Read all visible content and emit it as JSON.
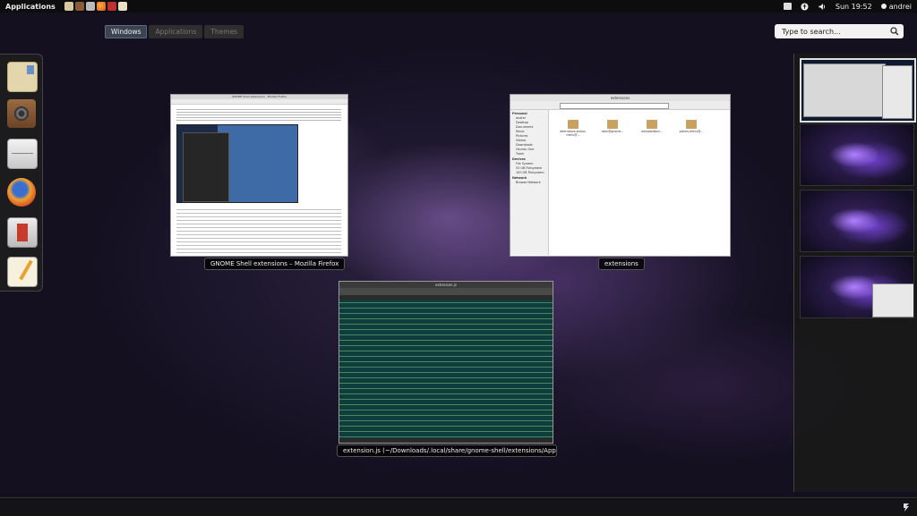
{
  "top_panel": {
    "applications_label": "Applications",
    "launchers": [
      {
        "icon": "mail-icon",
        "color": "#d9c9a0"
      },
      {
        "icon": "speaker-icon",
        "color": "#8a5a3a"
      },
      {
        "icon": "file-cabinet-icon",
        "color": "#bbbbbb"
      },
      {
        "icon": "firefox-icon",
        "color": "#e86f2a"
      },
      {
        "icon": "package-icon",
        "color": "#c03030"
      },
      {
        "icon": "text-editor-icon",
        "color": "#e8e0c0"
      }
    ],
    "clock": "Sun 19:52",
    "user": "andrei",
    "status_icons": [
      "folder-icon",
      "accessibility-icon",
      "volume-icon"
    ]
  },
  "tabs": [
    {
      "label": "Windows",
      "active": true
    },
    {
      "label": "Applications",
      "active": false
    },
    {
      "label": "Themes",
      "active": false
    }
  ],
  "search": {
    "placeholder": "Type to search..."
  },
  "dash": {
    "items": [
      {
        "icon": "mail-icon"
      },
      {
        "icon": "speaker-icon"
      },
      {
        "icon": "file-cabinet-icon"
      },
      {
        "icon": "firefox-icon"
      },
      {
        "icon": "package-icon"
      },
      {
        "icon": "text-editor-icon"
      }
    ]
  },
  "windows": [
    {
      "app": "firefox",
      "caption": "GNOME Shell extensions – Mozilla Firefox",
      "title": "GNOME Shell extensions - Mozilla Firefox"
    },
    {
      "app": "nautilus",
      "caption": "extensions",
      "title": "extensions",
      "sidebar": [
        "Personal",
        "andrei",
        "Desktop",
        "Documents",
        "Music",
        "Pictures",
        "Videos",
        "Downloads",
        "Ubuntu One",
        "Trash",
        "Devices",
        "File System",
        "53 GB Filesystem",
        "100 GB Filesystem",
        "Network",
        "Browse Network"
      ],
      "folders": [
        "alternative-status-menu@gnome-shell-extensions.gcampax.github.com",
        "dock@gnome-shell-extensions.gcampax.github.com",
        "windowsNavigator@gnome-shell-extensions.gcampax.github.com",
        "places-menu@gnome-shell-extensions.gcampax.github.com"
      ],
      "folders_short": [
        "alternative-status-menu@...",
        "dock@gnome...",
        "windowsNavi...",
        "places-menu@..."
      ]
    },
    {
      "app": "gedit",
      "caption": "extension.js (~/Downloads/.local/share/gnome-shell/extensions/App...",
      "title": "extension.js"
    }
  ],
  "workspaces": [
    {
      "index": 1,
      "active": true
    },
    {
      "index": 2,
      "active": false
    },
    {
      "index": 3,
      "active": false
    },
    {
      "index": 4,
      "active": false
    }
  ],
  "tray": {
    "icon": "notification-icon"
  }
}
